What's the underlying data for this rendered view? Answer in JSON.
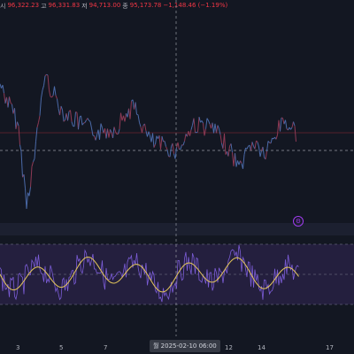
{
  "legend": {
    "open_label": "시",
    "open_value": "96,322.23",
    "high_label": "고",
    "high_value": "96,331.83",
    "low_label": "저",
    "low_value": "94,713.00",
    "close_label": "종",
    "close_value": "95,173.78",
    "change_value": "−1,148.46 (−1.19%)"
  },
  "colors": {
    "background": "#131722",
    "price_line": "#8e3a55",
    "price_line_alt": "#4b6aa8",
    "oscillator_raw": "#7b5cd6",
    "oscillator_signal": "#e6c85a",
    "osc_band": "#2a2446",
    "accent": "#a13df0"
  },
  "x_axis": {
    "ticks": [
      "3",
      "5",
      "7",
      "12",
      "14",
      "17"
    ],
    "crosshair_label": "월  2025-02-10   06:00"
  },
  "settings_icon": "gear-icon"
}
